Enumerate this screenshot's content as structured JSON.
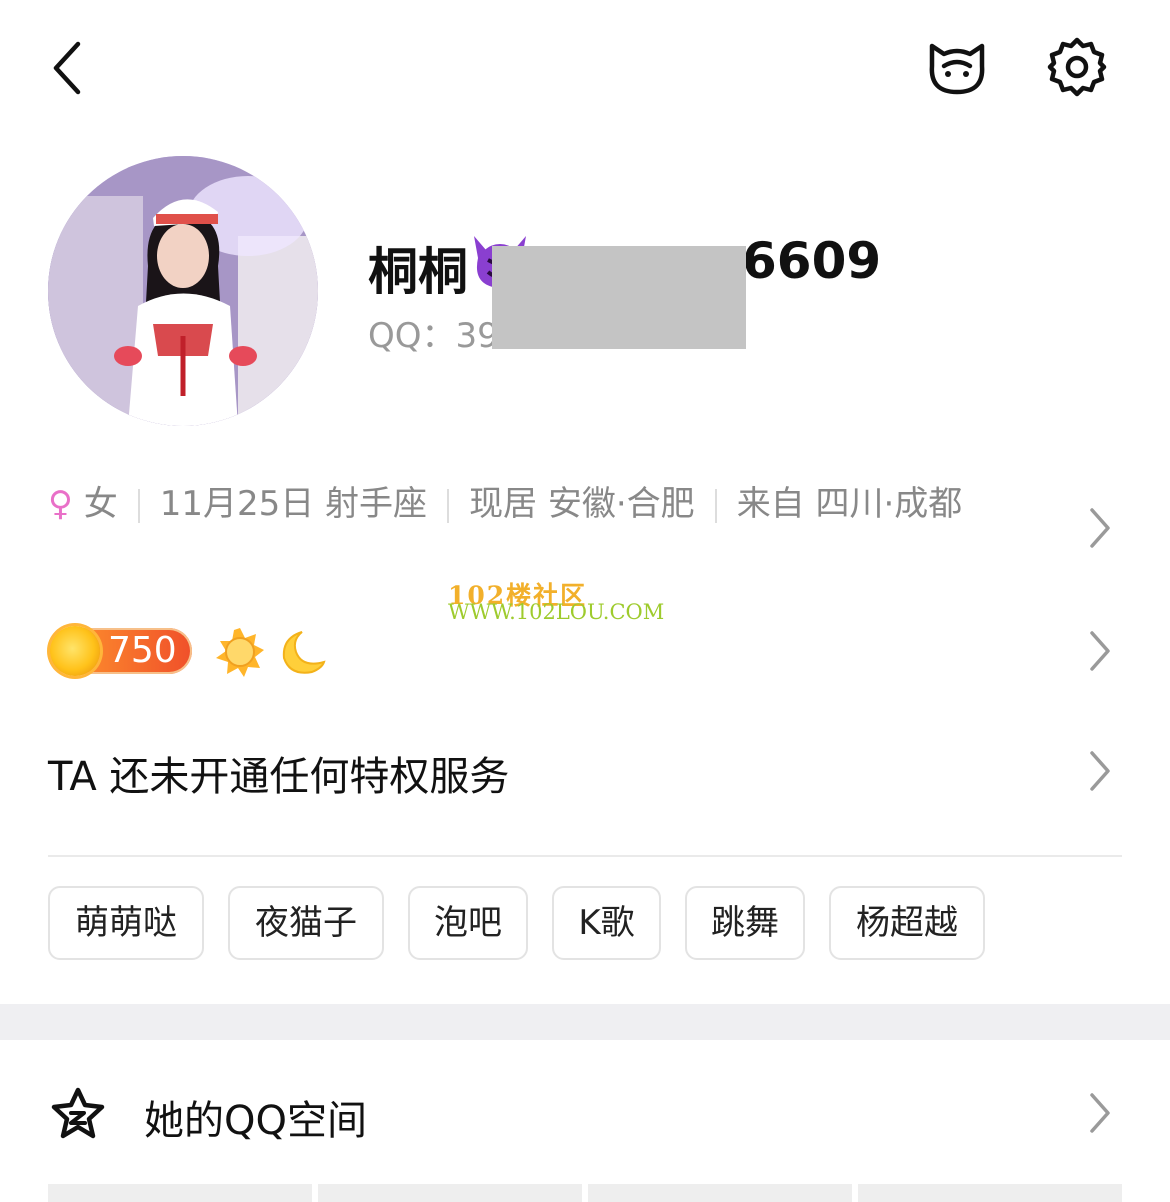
{
  "header": {
    "back_icon": "chevron-left-icon",
    "pet_icon": "pet-face-icon",
    "settings_icon": "gear-icon"
  },
  "profile": {
    "nickname_prefix": "桐桐",
    "nickname_suffix": "6609",
    "qq_label": "QQ：39",
    "badge_icon": "devil-emoji-icon"
  },
  "info": {
    "gender_symbol": "♀",
    "gender": "女",
    "birthday": "11月25日 射手座",
    "location": "现居 安徽·合肥",
    "hometown": "来自 四川·成都"
  },
  "watermark": {
    "line1": "102楼社区",
    "line2": "WWW.102LOU.COM"
  },
  "level": {
    "value": "750",
    "icons": [
      "sun-icon",
      "moon-icon"
    ]
  },
  "privilege": {
    "text": "TA 还未开通任何特权服务"
  },
  "tags": [
    "萌萌哒",
    "夜猫子",
    "泡吧",
    "K歌",
    "跳舞",
    "杨超越"
  ],
  "qzone": {
    "label": "她的QQ空间",
    "icon": "qzone-star-icon"
  },
  "colors": {
    "female": "#e970c8",
    "level_gradient_start": "#ff9a2e",
    "level_gradient_end": "#f0502a",
    "watermark_orange": "#f2b02b",
    "watermark_green": "#9ecb2d"
  }
}
